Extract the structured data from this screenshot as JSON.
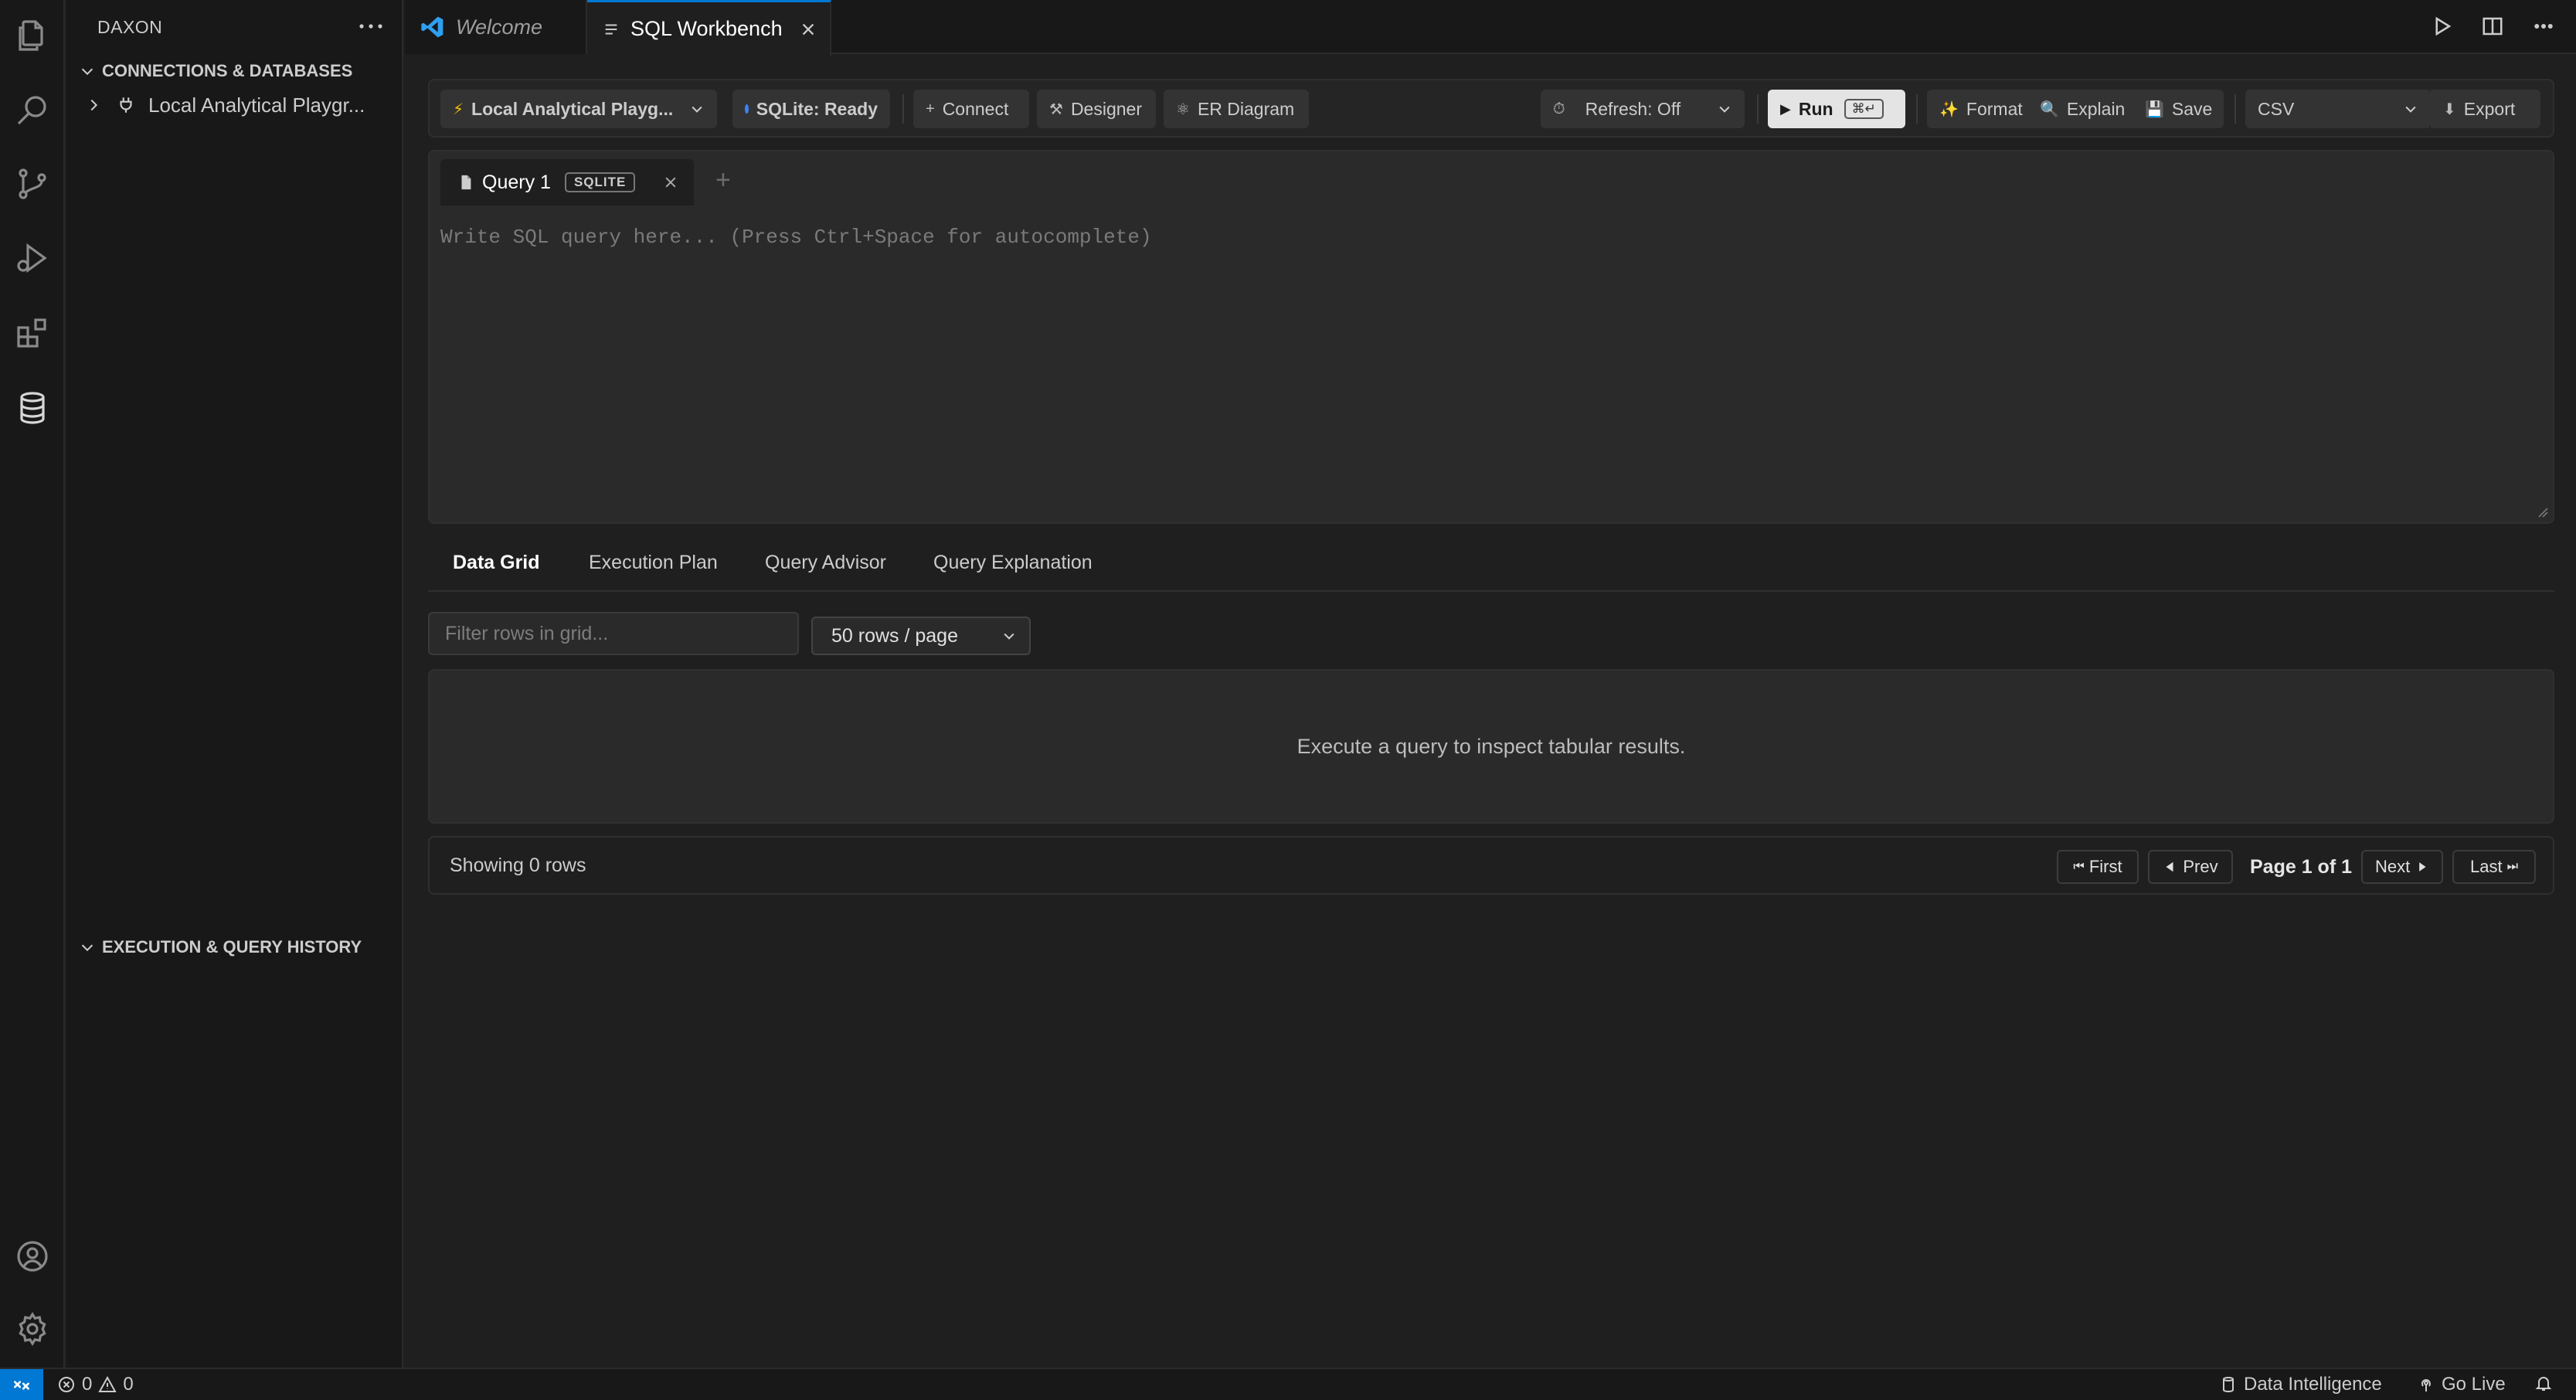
{
  "sidebar": {
    "title": "DAXON",
    "connections_header": "CONNECTIONS & DATABASES",
    "connection_item": "Local Analytical Playgr...",
    "history_header": "EXECUTION & QUERY HISTORY"
  },
  "tabs": [
    {
      "label": "Welcome",
      "active": false
    },
    {
      "label": "SQL Workbench",
      "active": true
    }
  ],
  "toolbar": {
    "connection_select": "Local Analytical Playg...",
    "status": "SQLite: Ready",
    "status_color": "#3b82f6",
    "connect": "Connect",
    "designer": "Designer",
    "er_diagram": "ER Diagram",
    "refresh": "Refresh: Off",
    "run": "Run",
    "run_shortcut": "⌘↵",
    "format": "Format",
    "explain": "Explain",
    "save": "Save",
    "export_format": "CSV",
    "export": "Export"
  },
  "editor": {
    "query_tab": "Query 1",
    "dialect_badge": "SQLITE",
    "add_tab": "+",
    "placeholder": "Write SQL query here... (Press Ctrl+Space for autocomplete)"
  },
  "result_tabs": [
    "Data Grid",
    "Execution Plan",
    "Query Advisor",
    "Query Explanation"
  ],
  "grid": {
    "filter_placeholder": "Filter rows in grid...",
    "page_size": "50 rows / page",
    "empty_message": "Execute a query to inspect tabular results."
  },
  "pager": {
    "showing": "Showing 0 rows",
    "first": "First",
    "prev": "Prev",
    "page_info": "Page 1 of 1",
    "next": "Next",
    "last": "Last"
  },
  "statusbar": {
    "errors": "0",
    "warnings": "0",
    "data_intelligence": "Data Intelligence",
    "go_live": "Go Live"
  },
  "colors": {
    "accent": "#0078d4",
    "background": "#1f1f1f"
  }
}
